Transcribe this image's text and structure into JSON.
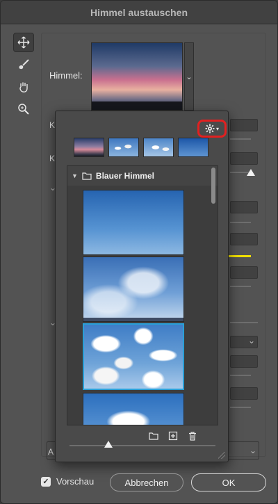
{
  "dialog": {
    "title": "Himmel austauschen"
  },
  "tools": [
    {
      "name": "move-tool-icon"
    },
    {
      "name": "sky-brush-icon"
    },
    {
      "name": "hand-tool-icon"
    },
    {
      "name": "zoom-tool-icon"
    }
  ],
  "sky": {
    "label": "Himmel:"
  },
  "background_letters": {
    "k1": "K",
    "k2": "K",
    "a": "A"
  },
  "popup": {
    "settings_icon": "gear-icon",
    "group_label": "Blauer Himmel"
  },
  "footer": {
    "preview_label": "Vorschau",
    "preview_checked": true,
    "cancel_label": "Abbrechen",
    "ok_label": "OK"
  },
  "colors": {
    "highlight": "#e22020",
    "selection": "#2a9fd6",
    "slider_color": "#f2e100"
  }
}
